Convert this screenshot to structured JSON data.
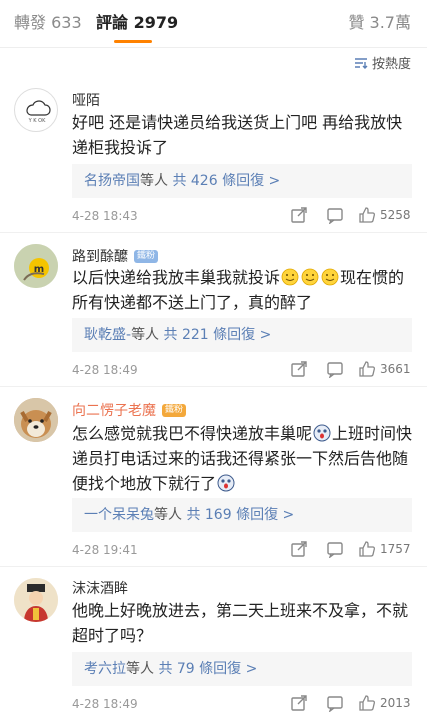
{
  "tabs": {
    "repost": "轉發 633",
    "comments": "評論 2979",
    "likes": "贊 3.7萬"
  },
  "sort": {
    "label": "按熱度"
  },
  "comments": [
    {
      "user": "哑陌",
      "text": "好吧 还是请快递员给我送货上门吧  再给我放快递柜我投诉了",
      "reply_user": "名扬帝国",
      "reply_suffix": "等人",
      "reply_count": "共 426 條回復 >",
      "date": "4-28 18:43",
      "likes": "5258"
    },
    {
      "user": "路到酴醿",
      "badge": "鐵粉",
      "text_a": "以后快递给我放丰巢我就投诉",
      "text_b": "现在惯的所有快递都不送上门了，真的醉了",
      "reply_user": "耿乾盛-",
      "reply_suffix": "等人",
      "reply_count": "共 221 條回復 >",
      "date": "4-28 18:49",
      "likes": "3661"
    },
    {
      "user": "向二愣子老魔",
      "badge": "鐵粉",
      "text_a": "怎么感觉就我巴不得快递放丰巢呢",
      "text_b": "上班时间快递员打电话过来的话我还得紧张一下然后告他随便找个地放下就行了",
      "reply_user": "一个呆呆兔",
      "reply_suffix": "等人",
      "reply_count": "共 169 條回復 >",
      "date": "4-28 19:41",
      "likes": "1757"
    },
    {
      "user": "沫沫酒眸",
      "text": "他晚上好晚放进去，第二天上班来不及拿，不就超时了吗？",
      "reply_user": "考六拉",
      "reply_suffix": "等人",
      "reply_count": "共 79 條回復 >",
      "date": "4-28 18:49",
      "likes": "2013"
    }
  ]
}
